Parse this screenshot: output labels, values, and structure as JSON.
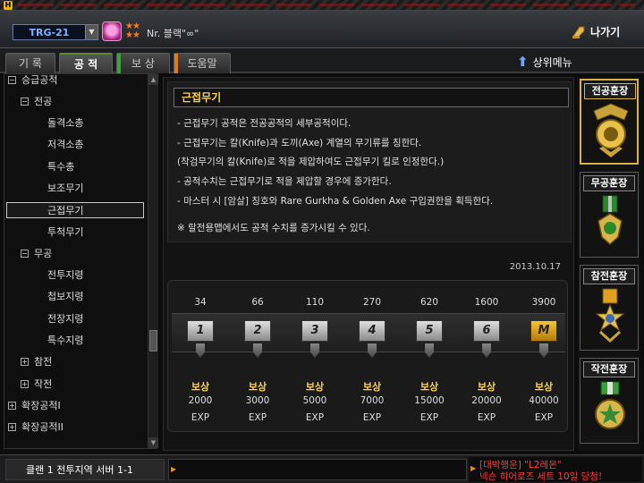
{
  "app": {
    "logo": "H"
  },
  "header": {
    "server": "TRG-21",
    "player_name": "Nr. 블랙\"∞\"",
    "exit_label": "나가기"
  },
  "tabs": [
    {
      "label": "기 록",
      "accent": ""
    },
    {
      "label": "공 적",
      "accent": ""
    },
    {
      "label": "보 상",
      "accent": "#3aa33a"
    },
    {
      "label": "도움말",
      "accent": "#e07a1a"
    }
  ],
  "up_menu_label": "상위메뉴",
  "sidebar": {
    "items": [
      {
        "label": "승급공적",
        "toggle": "⊟",
        "level": 0
      },
      {
        "label": "전공",
        "toggle": "⊟",
        "level": 1
      },
      {
        "label": "돌격소총",
        "toggle": "",
        "level": 2
      },
      {
        "label": "저격소총",
        "toggle": "",
        "level": 2
      },
      {
        "label": "특수총",
        "toggle": "",
        "level": 2
      },
      {
        "label": "보조무기",
        "toggle": "",
        "level": 2
      },
      {
        "label": "근접무기",
        "toggle": "",
        "level": 2,
        "selected": true
      },
      {
        "label": "투척무기",
        "toggle": "",
        "level": 2
      },
      {
        "label": "무공",
        "toggle": "⊟",
        "level": 1
      },
      {
        "label": "전투지령",
        "toggle": "",
        "level": 2
      },
      {
        "label": "첩보지령",
        "toggle": "",
        "level": 2
      },
      {
        "label": "전장지령",
        "toggle": "",
        "level": 2
      },
      {
        "label": "특수지령",
        "toggle": "",
        "level": 2
      },
      {
        "label": "참전",
        "toggle": "⊞",
        "level": 1
      },
      {
        "label": "작전",
        "toggle": "⊞",
        "level": 1
      },
      {
        "label": "확장공적I",
        "toggle": "⊞",
        "level": 0
      },
      {
        "label": "확장공적II",
        "toggle": "⊞",
        "level": 0
      }
    ]
  },
  "detail": {
    "title": "근접무기",
    "lines": [
      "- 근접무기 공적은 전공공적의 세부공적이다.",
      "- 근접무기는 칼(Knife)과 도끼(Axe) 계열의 무기류를 칭한다.",
      "  (착검무기의 칼(Knife)로 적을 제압하여도 근접무기 킬로 인정한다.)",
      "- 공적수치는 근접무기로 적을 제압할 경우에 증가한다.",
      "- 마스터 시 [암살] 칭호와 Rare Gurkha & Golden Axe 구입권한을 획득한다.",
      "",
      "※ 랄전용맵에서도 공적 수치를 증가시킬 수 있다."
    ],
    "date": "2013.10.17"
  },
  "rewards": {
    "steps": [
      {
        "required": "34",
        "badge": "1",
        "label": "보상",
        "amount": "2000",
        "unit": "EXP"
      },
      {
        "required": "66",
        "badge": "2",
        "label": "보상",
        "amount": "3000",
        "unit": "EXP"
      },
      {
        "required": "110",
        "badge": "3",
        "label": "보상",
        "amount": "5000",
        "unit": "EXP"
      },
      {
        "required": "270",
        "badge": "4",
        "label": "보상",
        "amount": "7000",
        "unit": "EXP"
      },
      {
        "required": "620",
        "badge": "5",
        "label": "보상",
        "amount": "15000",
        "unit": "EXP"
      },
      {
        "required": "1600",
        "badge": "6",
        "label": "보상",
        "amount": "20000",
        "unit": "EXP"
      },
      {
        "required": "3900",
        "badge": "M",
        "label": "보상",
        "amount": "40000",
        "unit": "EXP"
      }
    ]
  },
  "medals": [
    {
      "title": "전공훈장",
      "active": true,
      "color": "#e6c24a"
    },
    {
      "title": "무공훈장",
      "active": false,
      "color": "#4ab04a"
    },
    {
      "title": "참전훈장",
      "active": false,
      "color": "#e0a020"
    },
    {
      "title": "작전훈장",
      "active": false,
      "color": "#3aa03a"
    }
  ],
  "statusbar": {
    "clan": "클랜 1 전투지역 서버 1-1",
    "notice_line1": "[대박행운] \"L2레몬\"",
    "notice_line2": "넥슨 히어로즈 세트 10일 당첨!"
  }
}
